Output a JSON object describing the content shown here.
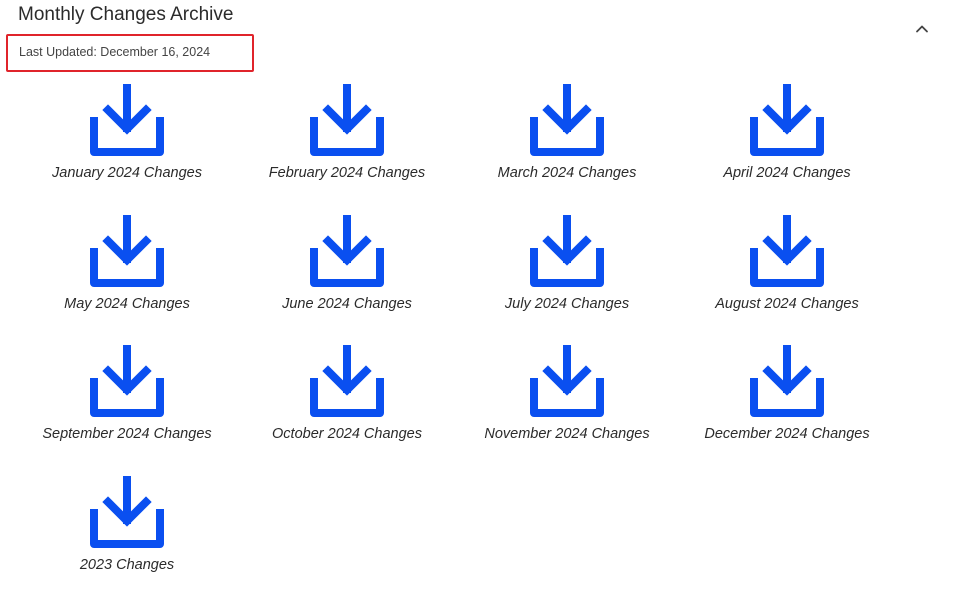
{
  "section": {
    "title": "Monthly Changes Archive",
    "toggle_icon": "chevron-up-icon",
    "last_updated": "Last Updated: December 16, 2024",
    "highlight_color": "#e0242b"
  },
  "downloads": {
    "icon": "download-icon",
    "icon_color": "#0a4ff0",
    "items": [
      {
        "label": "January 2024 Changes"
      },
      {
        "label": "February 2024 Changes"
      },
      {
        "label": "March 2024 Changes"
      },
      {
        "label": "April 2024 Changes"
      },
      {
        "label": "May 2024 Changes"
      },
      {
        "label": "June 2024 Changes"
      },
      {
        "label": "July 2024 Changes"
      },
      {
        "label": "August 2024 Changes"
      },
      {
        "label": "September 2024 Changes"
      },
      {
        "label": "October 2024 Changes"
      },
      {
        "label": "November 2024 Changes"
      },
      {
        "label": "December 2024 Changes"
      },
      {
        "label": "2023 Changes"
      }
    ]
  }
}
